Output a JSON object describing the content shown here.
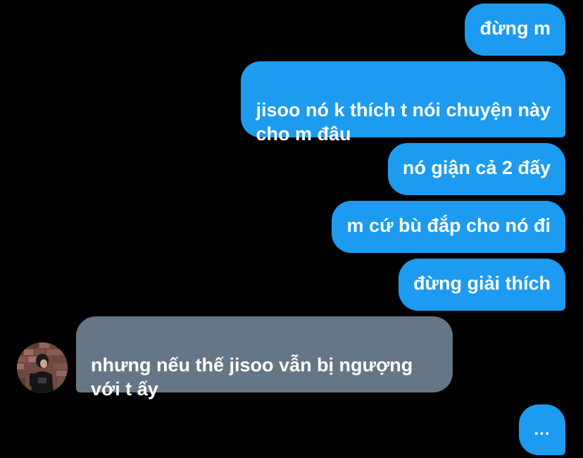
{
  "conversation": {
    "messages": [
      {
        "direction": "sent",
        "text": "đừng m"
      },
      {
        "direction": "sent",
        "text": "jisoo nó k thích t nói chuyện này\ncho m đâu"
      },
      {
        "direction": "sent",
        "text": "nó giận cả 2 đấy"
      },
      {
        "direction": "sent",
        "text": "m cứ bù đắp cho nó đi"
      },
      {
        "direction": "sent",
        "text": "đừng giải thích"
      },
      {
        "direction": "received",
        "text": "nhưng nếu thế jisoo vẫn bị ngượng\nvới t ấy"
      }
    ],
    "typing_indicator": "..."
  },
  "colors": {
    "background": "#000000",
    "sent_bubble": "#1d9bf0",
    "received_bubble": "#657786",
    "text": "#ffffff"
  },
  "icons": {
    "avatar": "avatar"
  }
}
